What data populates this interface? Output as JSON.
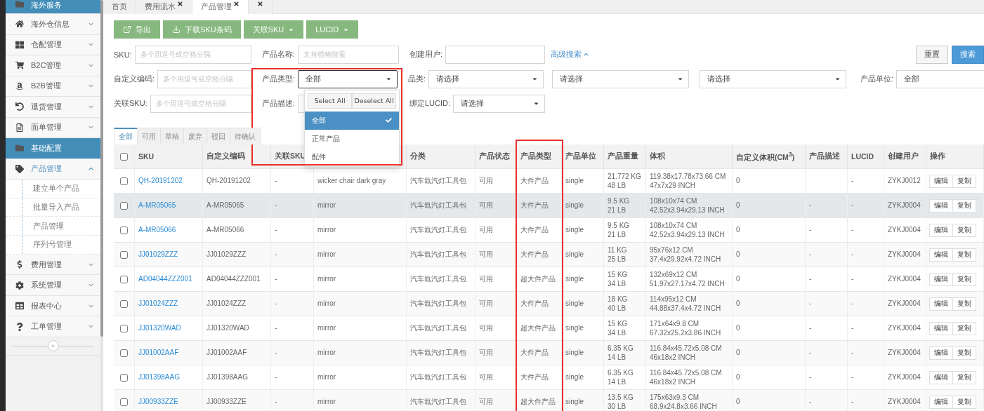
{
  "sidebar": {
    "items": [
      {
        "label": "海外服务",
        "kind": "section"
      },
      {
        "label": "海外仓信息",
        "kind": "menu",
        "expanded": false
      },
      {
        "label": "仓配管理",
        "kind": "menu",
        "expanded": false
      },
      {
        "label": "B2C管理",
        "kind": "menu",
        "expanded": false
      },
      {
        "label": "B2B管理",
        "kind": "menu",
        "expanded": false
      },
      {
        "label": "退货管理",
        "kind": "menu",
        "expanded": false
      },
      {
        "label": "面单管理",
        "kind": "menu",
        "expanded": false
      },
      {
        "label": "基础配置",
        "kind": "section"
      },
      {
        "label": "产品管理",
        "kind": "menu",
        "expanded": true,
        "children": [
          {
            "label": "建立单个产品"
          },
          {
            "label": "批量导入产品"
          },
          {
            "label": "产品管理"
          },
          {
            "label": "序列号管理"
          }
        ]
      },
      {
        "label": "费用管理",
        "kind": "menu",
        "expanded": false
      },
      {
        "label": "系统管理",
        "kind": "menu",
        "expanded": false
      },
      {
        "label": "报表中心",
        "kind": "menu",
        "expanded": false
      },
      {
        "label": "工单管理",
        "kind": "menu",
        "expanded": false
      }
    ],
    "collapse": "«"
  },
  "tabs": [
    {
      "label": "首页",
      "selected": false,
      "closable": false
    },
    {
      "label": "费用流水",
      "selected": false,
      "closable": true
    },
    {
      "label": "产品管理",
      "selected": true,
      "closable": true
    },
    {
      "selected": false,
      "closable": true
    }
  ],
  "toolbar": [
    {
      "label": "导出",
      "kind": "export",
      "dropdown": false
    },
    {
      "label": "下载SKU条码",
      "kind": "download",
      "dropdown": false
    },
    {
      "label": "关联SKU",
      "kind": "menu",
      "dropdown": true
    },
    {
      "label": "LUCID",
      "kind": "menu",
      "dropdown": true
    }
  ],
  "filters": {
    "rows": [
      [
        {
          "label": "SKU:",
          "kind": "input",
          "placeholder": "多个用逗号或空格分隔"
        },
        {
          "label": "产品名称:",
          "kind": "input",
          "placeholder": "支持模糊搜索"
        },
        {
          "label": "创建用户:",
          "kind": "input"
        }
      ],
      [
        {
          "label": "自定义编码:",
          "kind": "input",
          "placeholder": "多个用逗号或空格分隔"
        },
        {
          "label": "产品类型:",
          "kind": "select",
          "value": "全部",
          "active": true,
          "highlighted": true,
          "dropdown": {
            "actions": [
              "Select All",
              "Deselect All"
            ],
            "options": [
              {
                "label": "全部",
                "selected": true
              },
              {
                "label": "正常产品",
                "selected": false
              },
              {
                "label": "配件",
                "selected": false
              }
            ]
          }
        },
        {
          "label": "品类:",
          "kind": "select",
          "value": "请选择"
        },
        {
          "kind": "select",
          "value": "请选择"
        },
        {
          "kind": "select",
          "value": "请选择"
        },
        {
          "label": "产品单位:",
          "kind": "select",
          "value": "全部"
        }
      ],
      [
        {
          "label": "关联SKU:",
          "kind": "input",
          "placeholder": "多个用逗号或空格分隔"
        },
        {
          "label": "产品描述:",
          "kind": "input"
        },
        {
          "label": "绑定LUCID:",
          "kind": "select",
          "value": "请选择"
        }
      ]
    ],
    "advanced_link": "高级搜索",
    "buttons": [
      {
        "label": "重置",
        "kind": "default"
      },
      {
        "label": "搜索",
        "kind": "primary"
      }
    ]
  },
  "status_tabs": [
    {
      "label": "全部",
      "selected": true
    },
    {
      "label": "可用",
      "selected": false
    },
    {
      "label": "草稿",
      "selected": false
    },
    {
      "label": "废弃",
      "selected": false
    },
    {
      "label": "驳回",
      "selected": false
    },
    {
      "label": "待确认",
      "selected": false
    }
  ],
  "table": {
    "header_checked": false,
    "columns": [
      {
        "label": "SKU"
      },
      {
        "label": "自定义编码"
      },
      {
        "label": "关联SKU"
      },
      {},
      {
        "label": "分类"
      },
      {
        "label": "产品状态"
      },
      {
        "label": "产品类型",
        "highlighted": true
      },
      {
        "label": "产品单位"
      },
      {
        "label": "产品重量"
      },
      {
        "label": "体积"
      },
      {
        "label": "自定义体积(CM$^{3}$)"
      },
      {
        "label": "产品描述"
      },
      {
        "label": "LUCID"
      },
      {
        "label": "创建用户"
      },
      {
        "label": "操作"
      }
    ],
    "rows": [
      {
        "checked": false,
        "hovered": false,
        "cells": [
          "QH-20191202",
          "QH-20191202",
          "-",
          "wicker chair dark gray",
          "汽车氙汽灯工具包",
          "可用",
          "大件产品",
          "single",
          "21.772 KG\n48 LB",
          "119.38x17.78x73.66 CM\n47x7x29 INCH",
          "0",
          "",
          "-",
          "ZYKJ0012"
        ],
        "actions": [
          "编辑",
          "复制"
        ]
      },
      {
        "checked": false,
        "hovered": true,
        "cells": [
          "A-MR05065",
          "A-MR05065",
          "-",
          "mirror",
          "汽车氙汽灯工具包",
          "可用",
          "大件产品",
          "single",
          "9.5 KG\n21 LB",
          "108x10x74 CM\n42.52x3.94x29.13 INCH",
          "0",
          "-",
          "-",
          "ZYKJ0004"
        ],
        "actions": [
          "编辑",
          "复制"
        ]
      },
      {
        "checked": false,
        "hovered": false,
        "cells": [
          "A-MR05066",
          "A-MR05066",
          "-",
          "mirror",
          "汽车氙汽灯工具包",
          "可用",
          "大件产品",
          "single",
          "9.5 KG\n21 LB",
          "108x10x74 CM\n42.52x3.94x29.13 INCH",
          "0",
          "-",
          "-",
          "ZYKJ0004"
        ],
        "actions": [
          "编辑",
          "复制"
        ]
      },
      {
        "checked": false,
        "hovered": false,
        "cells": [
          "JJ01029ZZZ",
          "JJ01029ZZZ",
          "-",
          "mirror",
          "汽车氙汽灯工具包",
          "可用",
          "大件产品",
          "single",
          "11 KG\n25 LB",
          "95x76x12 CM\n37.4x29.92x4.72 INCH",
          "0",
          "-",
          "-",
          "ZYKJ0004"
        ],
        "actions": [
          "编辑",
          "复制"
        ]
      },
      {
        "checked": false,
        "hovered": false,
        "cells": [
          "AD04044ZZZ001",
          "AD04044ZZZ001",
          "-",
          "mirror",
          "汽车氙汽灯工具包",
          "可用",
          "超大件产品",
          "single",
          "15 KG\n34 LB",
          "132x69x12 CM\n51.97x27.17x4.72 INCH",
          "0",
          "-",
          "-",
          "ZYKJ0004"
        ],
        "actions": [
          "编辑",
          "复制"
        ]
      },
      {
        "checked": false,
        "hovered": false,
        "cells": [
          "JJ01024ZZZ",
          "JJ01024ZZZ",
          "-",
          "mirror",
          "汽车氙汽灯工具包",
          "可用",
          "大件产品",
          "single",
          "18 KG\n40 LB",
          "114x95x12 CM\n44.88x37.4x4.72 INCH",
          "0",
          "-",
          "-",
          "ZYKJ0004"
        ],
        "actions": [
          "编辑",
          "复制"
        ]
      },
      {
        "checked": false,
        "hovered": false,
        "cells": [
          "JJ01320WAD",
          "JJ01320WAD",
          "-",
          "mirror",
          "汽车氙汽灯工具包",
          "可用",
          "超大件产品",
          "single",
          "15 KG\n34 LB",
          "171x64x9.8 CM\n67.32x25.2x3.86 INCH",
          "0",
          "-",
          "-",
          "ZYKJ0004"
        ],
        "actions": [
          "编辑",
          "复制"
        ]
      },
      {
        "checked": false,
        "hovered": false,
        "cells": [
          "JJ01002AAF",
          "JJ01002AAF",
          "-",
          "mirror",
          "汽车氙汽灯工具包",
          "可用",
          "大件产品",
          "single",
          "6.35 KG\n14 LB",
          "116.84x45.72x5.08 CM\n46x18x2 INCH",
          "0",
          "-",
          "-",
          "ZYKJ0004"
        ],
        "actions": [
          "编辑",
          "复制"
        ]
      },
      {
        "checked": false,
        "hovered": false,
        "cells": [
          "JJ01398AAG",
          "JJ01398AAG",
          "-",
          "mirror",
          "汽车氙汽灯工具包",
          "可用",
          "大件产品",
          "single",
          "6.35 KG\n14 LB",
          "116.84x45.72x5.08 CM\n46x18x2 INCH",
          "0",
          "-",
          "-",
          "ZYKJ0004"
        ],
        "actions": [
          "编辑",
          "复制"
        ]
      },
      {
        "checked": false,
        "hovered": false,
        "cells": [
          "JJ00933ZZE",
          "JJ00933ZZE",
          "-",
          "mirror",
          "汽车氙汽灯工具包",
          "可用",
          "超大件产品",
          "single",
          "13.5 KG\n30 LB",
          "175x63x9.3 CM\n68.9x24.8x3.66 INCH",
          "0",
          "-",
          "-",
          "ZYKJ0004"
        ],
        "actions": [
          "编辑",
          "复制"
        ]
      }
    ]
  }
}
